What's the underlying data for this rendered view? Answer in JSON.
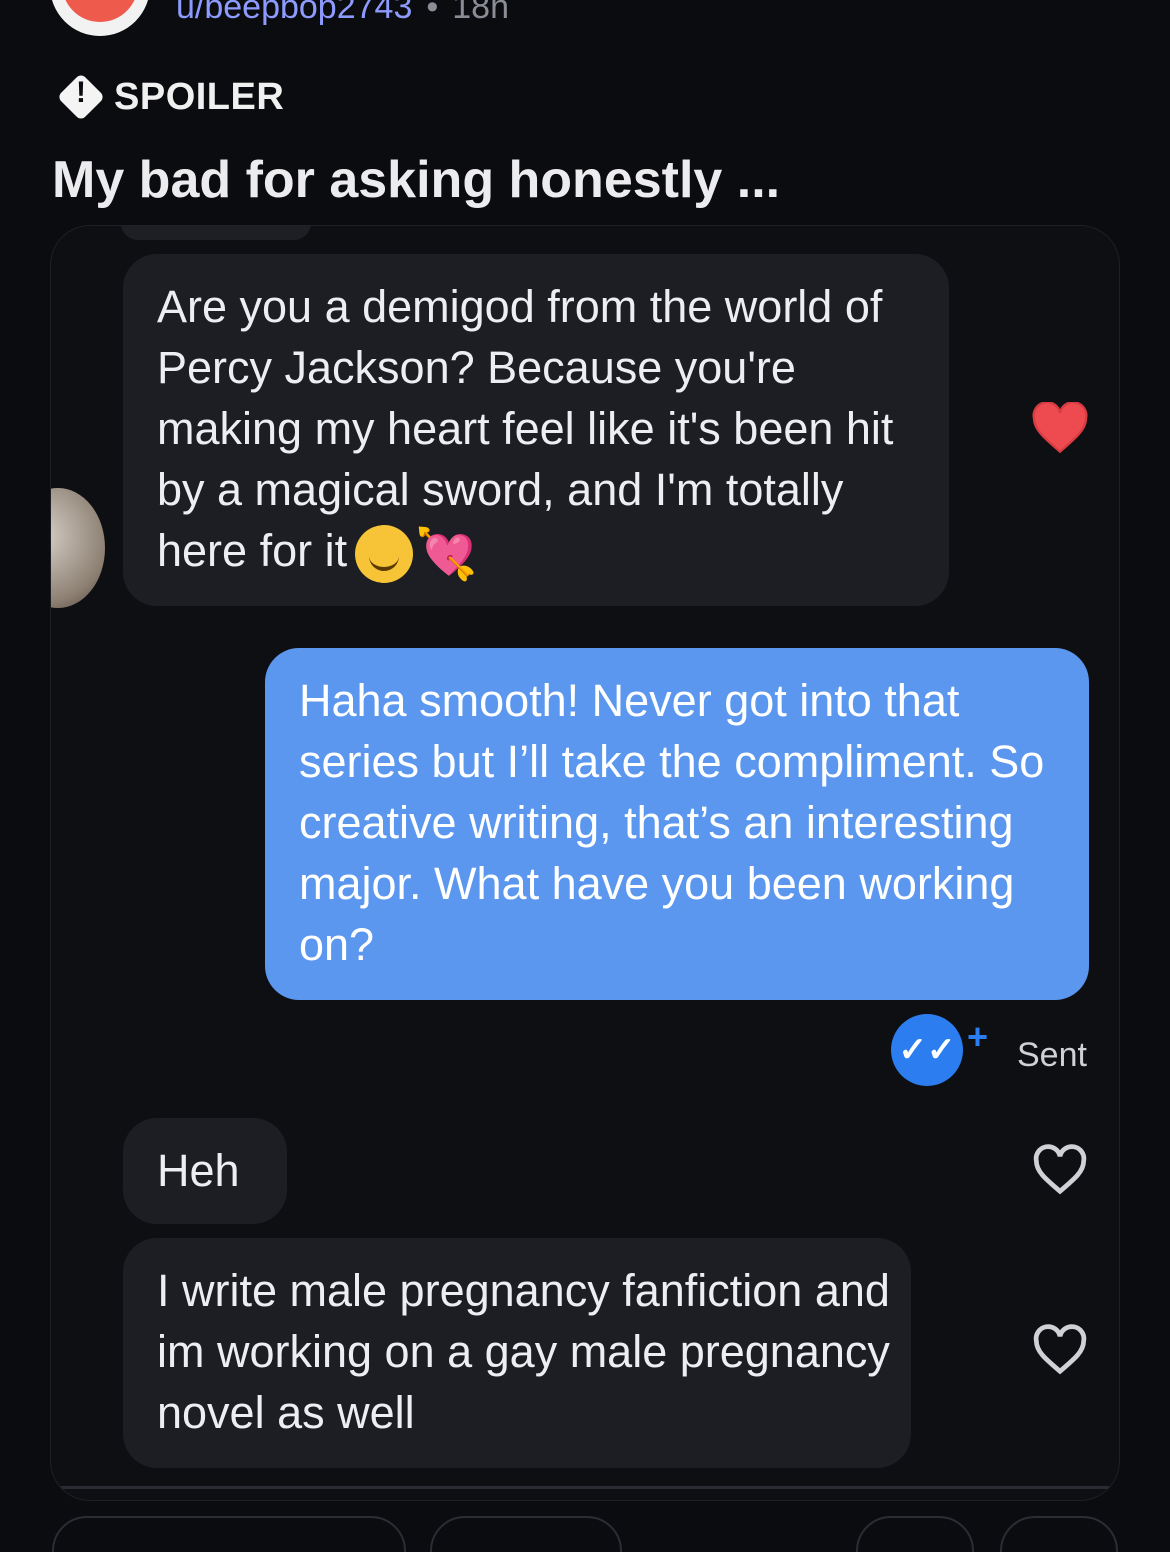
{
  "post": {
    "username": "u/beepbop2743",
    "separator": "•",
    "age": "18h",
    "spoiler_label": "SPOILER",
    "title": "My bad for asking honestly ..."
  },
  "messages": [
    {
      "direction": "incoming",
      "text": "Are you a demigod from the world of Percy Jackson? Because you're making my heart feel like it's been hit by a magical sword, and I'm totally here for it",
      "emojis": [
        "smiling-face-emoji",
        "heart-with-arrow-emoji"
      ],
      "liked": true
    },
    {
      "direction": "outgoing",
      "text": "Haha smooth! Never got into that series but I’ll take the compliment. So creative writing, that’s an interesting major. What have you been working on?"
    },
    {
      "direction": "incoming",
      "text": "Heh",
      "liked": false
    },
    {
      "direction": "incoming",
      "text": "I write male pregnancy fanfiction and im working on a gay male pregnancy novel as well",
      "liked": false
    }
  ],
  "status": {
    "read_receipt_icon": "double-check-icon",
    "plus_glyph": "+",
    "sent_label": "Sent"
  },
  "colors": {
    "background": "#0b0c0f",
    "incoming_bubble": "#1c1e24",
    "outgoing_bubble": "#5b97ee",
    "liked_heart": "#ee4b50",
    "read_badge": "#2c7ef0"
  }
}
